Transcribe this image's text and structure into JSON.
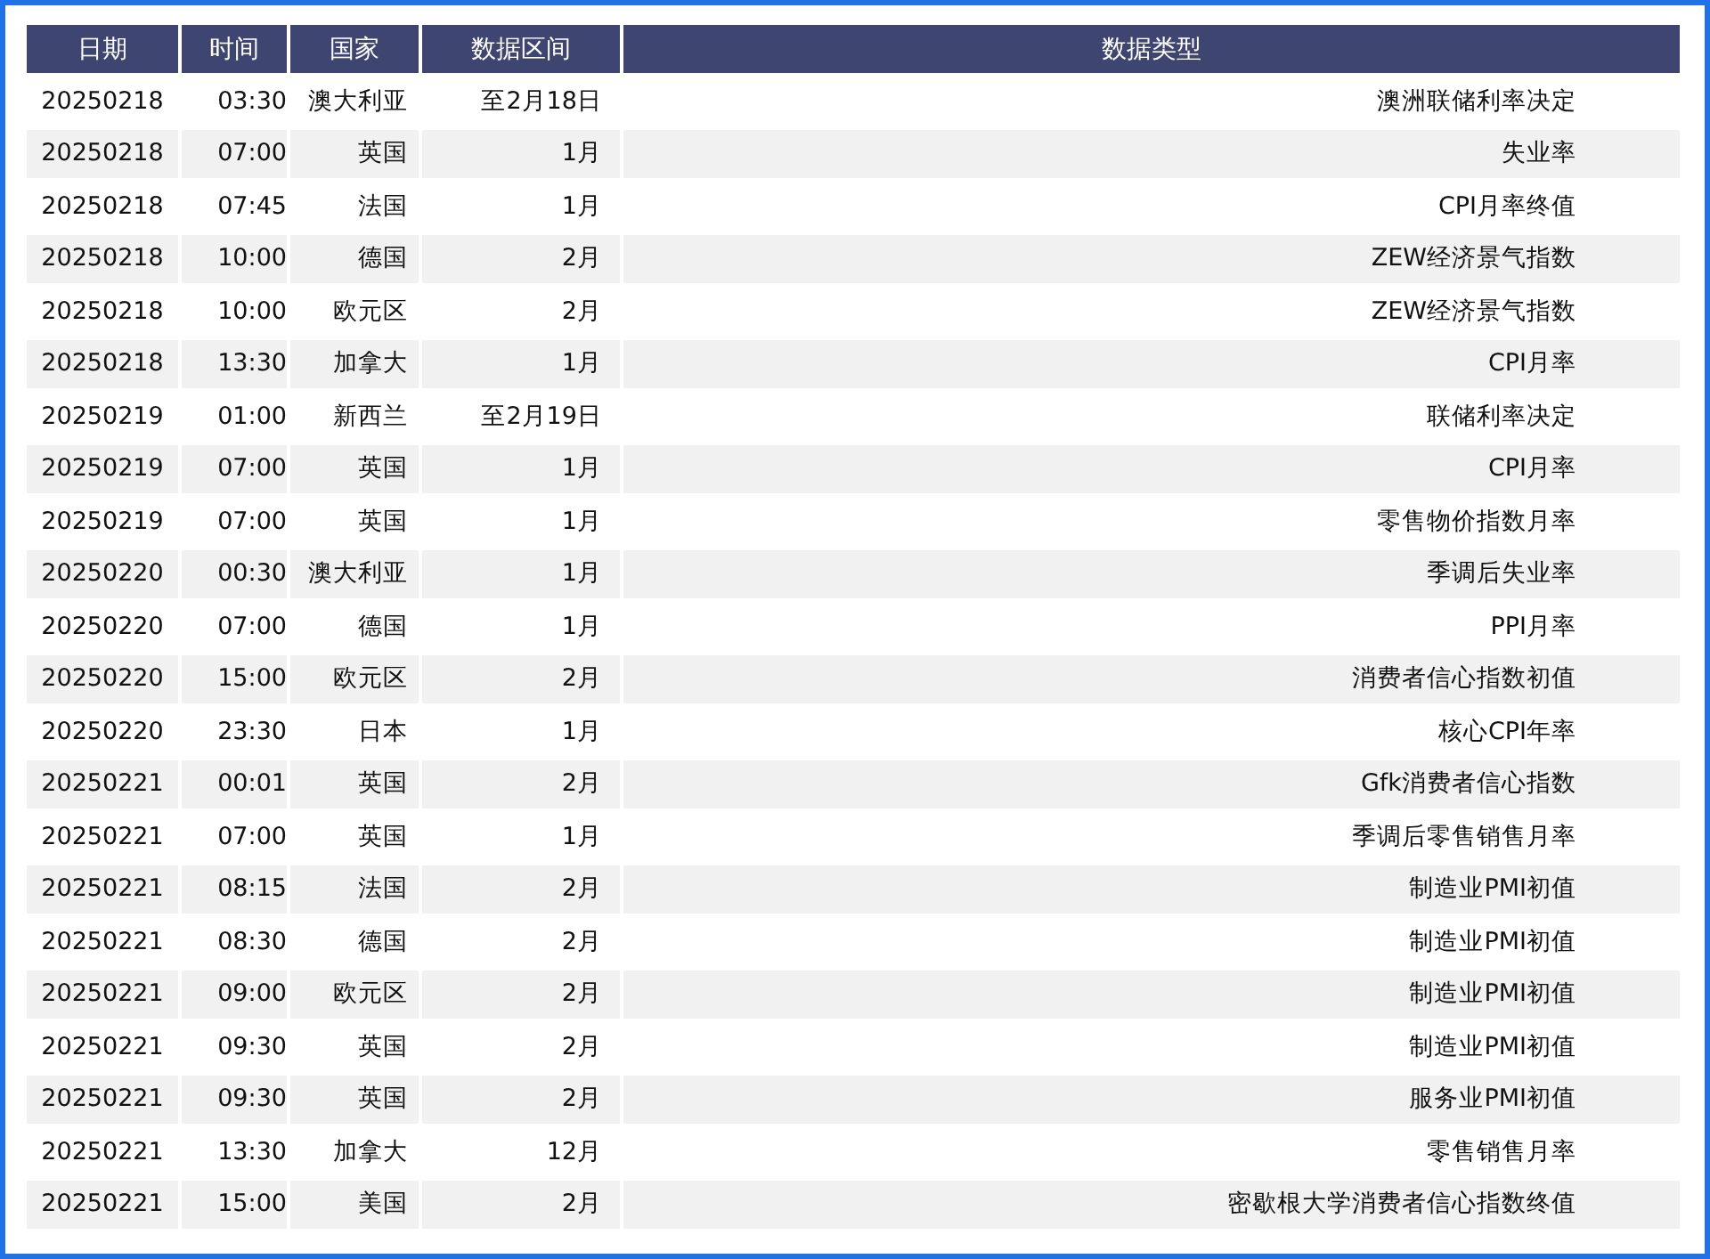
{
  "table": {
    "columns": [
      "日期",
      "时间",
      "国家",
      "数据区间",
      "数据类型"
    ],
    "rows": [
      [
        "20250218",
        "03:30",
        "澳大利亚",
        "至2月18日",
        "澳洲联储利率决定"
      ],
      [
        "20250218",
        "07:00",
        "英国",
        "1月",
        "失业率"
      ],
      [
        "20250218",
        "07:45",
        "法国",
        "1月",
        "CPI月率终值"
      ],
      [
        "20250218",
        "10:00",
        "德国",
        "2月",
        "ZEW经济景气指数"
      ],
      [
        "20250218",
        "10:00",
        "欧元区",
        "2月",
        "ZEW经济景气指数"
      ],
      [
        "20250218",
        "13:30",
        "加拿大",
        "1月",
        "CPI月率"
      ],
      [
        "20250219",
        "01:00",
        "新西兰",
        "至2月19日",
        "联储利率决定"
      ],
      [
        "20250219",
        "07:00",
        "英国",
        "1月",
        "CPI月率"
      ],
      [
        "20250219",
        "07:00",
        "英国",
        "1月",
        "零售物价指数月率"
      ],
      [
        "20250220",
        "00:30",
        "澳大利亚",
        "1月",
        "季调后失业率"
      ],
      [
        "20250220",
        "07:00",
        "德国",
        "1月",
        "PPI月率"
      ],
      [
        "20250220",
        "15:00",
        "欧元区",
        "2月",
        "消费者信心指数初值"
      ],
      [
        "20250220",
        "23:30",
        "日本",
        "1月",
        "核心CPI年率"
      ],
      [
        "20250221",
        "00:01",
        "英国",
        "2月",
        "Gfk消费者信心指数"
      ],
      [
        "20250221",
        "07:00",
        "英国",
        "1月",
        "季调后零售销售月率"
      ],
      [
        "20250221",
        "08:15",
        "法国",
        "2月",
        "制造业PMI初值"
      ],
      [
        "20250221",
        "08:30",
        "德国",
        "2月",
        "制造业PMI初值"
      ],
      [
        "20250221",
        "09:00",
        "欧元区",
        "2月",
        "制造业PMI初值"
      ],
      [
        "20250221",
        "09:30",
        "英国",
        "2月",
        "制造业PMI初值"
      ],
      [
        "20250221",
        "09:30",
        "英国",
        "2月",
        "服务业PMI初值"
      ],
      [
        "20250221",
        "13:30",
        "加拿大",
        "12月",
        "零售销售月率"
      ],
      [
        "20250221",
        "15:00",
        "美国",
        "2月",
        "密歇根大学消费者信心指数终值"
      ]
    ]
  }
}
